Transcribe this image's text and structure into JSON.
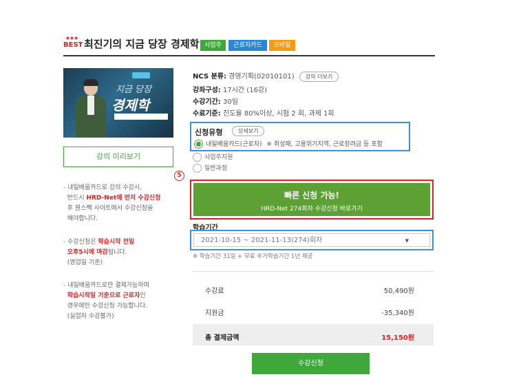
{
  "header": {
    "best_stars": "★★★",
    "best_label": "BEST",
    "title": "최진기의 지금 당장 경제학",
    "tags": [
      "사업주",
      "근로자카드",
      "모바일"
    ],
    "tag_colors": [
      "#3fa83b",
      "#2c86d6",
      "#f39c12"
    ]
  },
  "thumbnail": {
    "text_line1": "지금 당장",
    "text_line2": "경제학"
  },
  "preview_button": "강의 미리보기",
  "notes": {
    "n1_a": "- 내일배움카드로 강의 수강시,",
    "n1_b": "반드시 ",
    "n1_red": "HRD-Net에 먼저 수강신청",
    "n1_c": "후 원스쩩 사이트에서 수강신청을",
    "n1_d": "해야합니다.",
    "n2_a": "- 수강신청은 ",
    "n2_red1": "학습시작 전일",
    "n2_red2": "오후5시에 마감",
    "n2_b": "됩니다.",
    "n2_c": "(영업일 기준)",
    "n3_a": "- 내일배움카드로만 결제가능하며",
    "n3_red": "학습시작일 기준으로 근로자",
    "n3_b": "인",
    "n3_c": "경우에만 수강신청 가능합니다.",
    "n3_d": "(실업자 수강불가)"
  },
  "info": {
    "ncs_label": "NCS 분류:",
    "ncs_value": "경영기획(02010101)",
    "more_courses": "강의 더보기",
    "composition_label": "강좌구성:",
    "composition_value": "17시간 (16강)",
    "period_label": "수강기간:",
    "period_value": "30일",
    "criteria_label": "수료기준:",
    "criteria_value": "진도율 80%이상, 시험 2 회, 과제 1회"
  },
  "apply_type": {
    "label": "신청유형",
    "detail_button": "상세보기",
    "option1": "내일배움카드(근로자)",
    "option1_note": "※ 취성패, 고용위기지역, 근로장려금 등 포함",
    "option2": "사업주지원",
    "option3": "일반과정"
  },
  "step_marker": "5",
  "quick_apply": {
    "line1": "빠른 신청 가능!",
    "line2": "HRD-Net 274회차 수강신청 바로가기"
  },
  "study_period": {
    "label": "학습기간",
    "selected": "2021-10-15 ~ 2021-11-13(274)회차",
    "caret": "▼",
    "note": "※ 학습기간 31일 + 무료 추가학습기간 1년 제공"
  },
  "price": {
    "fee_label": "수강료",
    "fee_value": "50,490원",
    "support_label": "지원금",
    "support_value": "-35,340원",
    "total_label": "총 결제금액",
    "total_value": "15,150원"
  },
  "submit_button": "수강신청"
}
